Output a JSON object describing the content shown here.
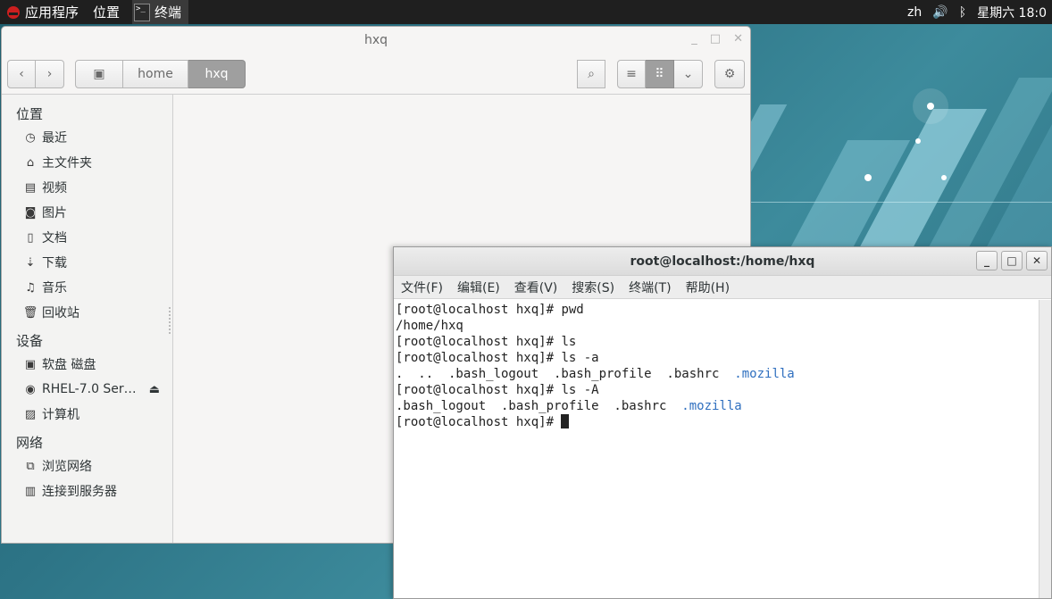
{
  "topbar": {
    "apps": "应用程序",
    "places": "位置",
    "terminal_app": "终端",
    "lang": "zh",
    "clock": "星期六 18:0"
  },
  "files": {
    "title": "hxq",
    "breadcrumb": [
      "home",
      "hxq"
    ],
    "sidebar": {
      "places_head": "位置",
      "places": [
        "最近",
        "主文件夹",
        "视频",
        "图片",
        "文档",
        "下载",
        "音乐",
        "回收站"
      ],
      "devices_head": "设备",
      "devices": [
        "软盘 磁盘",
        "RHEL-7.0 Ser…",
        "计算机"
      ],
      "network_head": "网络",
      "network": [
        "浏览网络",
        "连接到服务器"
      ]
    }
  },
  "terminal": {
    "title": "root@localhost:/home/hxq",
    "menu": [
      "文件(F)",
      "编辑(E)",
      "查看(V)",
      "搜索(S)",
      "终端(T)",
      "帮助(H)"
    ],
    "prompt": "[root@localhost hxq]# ",
    "l1_cmd": "pwd",
    "l2": "/home/hxq",
    "l3_cmd": "ls",
    "l4_cmd": "ls -a",
    "l5_plain": ".  ..  .bash_logout  .bash_profile  .bashrc  ",
    "l5_dir": ".mozilla",
    "l6_cmd": "ls -A",
    "l7_plain": ".bash_logout  .bash_profile  .bashrc  ",
    "l7_dir": ".mozilla"
  }
}
